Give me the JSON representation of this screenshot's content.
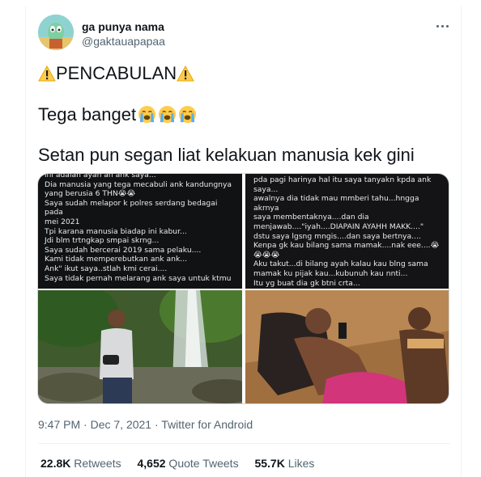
{
  "author": {
    "name": "ga punya nama",
    "handle": "@gaktauapapaa"
  },
  "tweet": {
    "line1": "PENCABULAN",
    "line2": "Tega banget",
    "line3": "Setan pun segan liat kelakuan manusia kek gini"
  },
  "media": {
    "left_screenshot_text": "ini adalah ayah an ank saya...\nDia manusia  yang tega mecabuli ank kandungnya\nyang berusia 6 THN😭😭\nSaya sudah melapor k polres serdang bedagai pada\nmei 2021\nTpi karana manusia biadap ini kabur...\nJdi blm trtngkap smpai skrng...\nSaya sudah bercerai 2019 sama pelaku....\nKami tidak memperebutkan ank ank...\nAnk\" ikut saya..stlah kmi cerai....\nSaya tidak pernah melarang ank saya untuk ktmu",
    "right_screenshot_text": "pda pagi harinya hal itu saya tanyakn kpda ank\nsaya...\nawalnya dia tidak mau mmberi tahu...hngga akrnya\nsaya membentaknya....dan dia\nmenjawab....\"iyah....DIAPAIN AYAHH MAKK....\"\ndstu saya lgsng mngis....dan saya bertnya....\nKenpa gk kau bilang sama mamak....nak eee....😭\n😭😭😭\nAku takut...di bilang ayah kalau kau blng sama\nmamak ku pijak kau...kubunuh kau nnti...\nItu yg buat dia gk btni crta..."
  },
  "meta": {
    "time": "9:47 PM",
    "separator": " · ",
    "date": "Dec 7, 2021",
    "source": "Twitter for Android"
  },
  "stats": {
    "retweets_count": "22.8K",
    "retweets_label": " Retweets",
    "quotes_count": "4,652",
    "quotes_label": " Quote Tweets",
    "likes_count": "55.7K",
    "likes_label": " Likes"
  },
  "colors": {
    "text_primary": "#0f1419",
    "text_secondary": "#536471",
    "divider": "#eff3f4"
  },
  "icons": [
    "avatar",
    "more-icon",
    "warning-icon",
    "crying-face-icon"
  ]
}
